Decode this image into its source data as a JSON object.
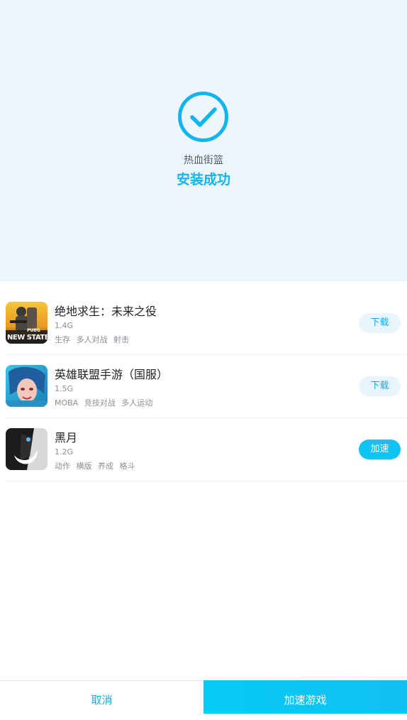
{
  "hero": {
    "app_name": "热血街篮",
    "status": "安装成功",
    "accent_color": "#10b4ee",
    "icon": "check-circle-icon"
  },
  "games": [
    {
      "title": "绝地求生：未来之役",
      "size": "1.4G",
      "tags": [
        "生存",
        "多人对战",
        "射击"
      ],
      "action": "下载",
      "thumb_text_top": "PUBG",
      "thumb_text_main": "NEW STATE"
    },
    {
      "title": "英雄联盟手游（国服）",
      "size": "1.5G",
      "tags": [
        "MOBA",
        "竞技对战",
        "多人运动"
      ],
      "action": "下载"
    },
    {
      "title": "黑月",
      "size": "1.2G",
      "tags": [
        "动作",
        "横版",
        "养成",
        "格斗"
      ],
      "action": "加速"
    }
  ],
  "footer": {
    "cancel_label": "取消",
    "accelerate_label": "加速游戏"
  }
}
